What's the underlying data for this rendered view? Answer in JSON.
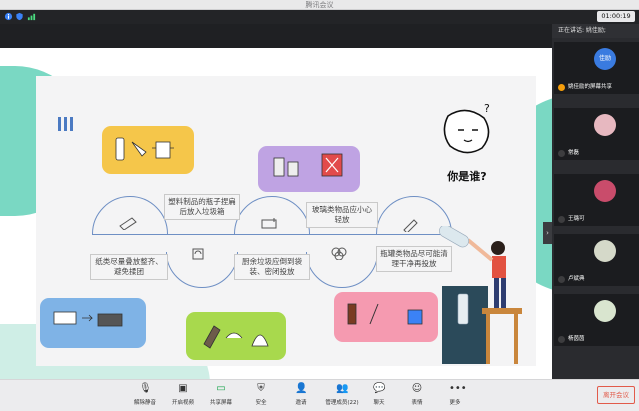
{
  "window": {
    "title": "腾讯会议",
    "timer": "01:00:19"
  },
  "slide": {
    "question": "你是谁?",
    "topics": [
      "塑料制品的瓶子捏扁后放入垃圾箱",
      "玻璃类物品应小心轻放",
      "纸类尽量叠放整齐、避免揉团",
      "厨余垃圾应倒到袋装、密闭投放",
      "瓶罐类物品尽可能清理干净再投放"
    ]
  },
  "speaking": {
    "label": "正在讲话: 姚佳励;"
  },
  "participants": [
    {
      "name": "姚佳励的屏幕共享",
      "avatar_text": "佳励",
      "color": "#3a7be0"
    },
    {
      "name": "常磊",
      "avatar_text": "",
      "color": "#e7b8c0"
    },
    {
      "name": "王璐可",
      "avatar_text": "",
      "color": "#c94c6b"
    },
    {
      "name": "卢斌典",
      "avatar_text": "",
      "color": "#d5d9c9"
    },
    {
      "name": "杨茵茵",
      "avatar_text": "",
      "color": "#d9e5cf"
    }
  ],
  "controls": [
    {
      "label": "解除静音",
      "icon": "mic-off-icon"
    },
    {
      "label": "开启视频",
      "icon": "video-off-icon"
    },
    {
      "label": "共享屏幕",
      "icon": "screen-share-icon"
    },
    {
      "label": "安全",
      "icon": "shield-icon"
    },
    {
      "label": "邀请",
      "icon": "invite-icon"
    },
    {
      "label": "管理成员(22)",
      "icon": "members-icon"
    },
    {
      "label": "聊天",
      "icon": "chat-icon"
    },
    {
      "label": "表情",
      "icon": "emoji-icon"
    },
    {
      "label": "更多",
      "icon": "more-icon"
    }
  ],
  "leave_label": "离开会议"
}
